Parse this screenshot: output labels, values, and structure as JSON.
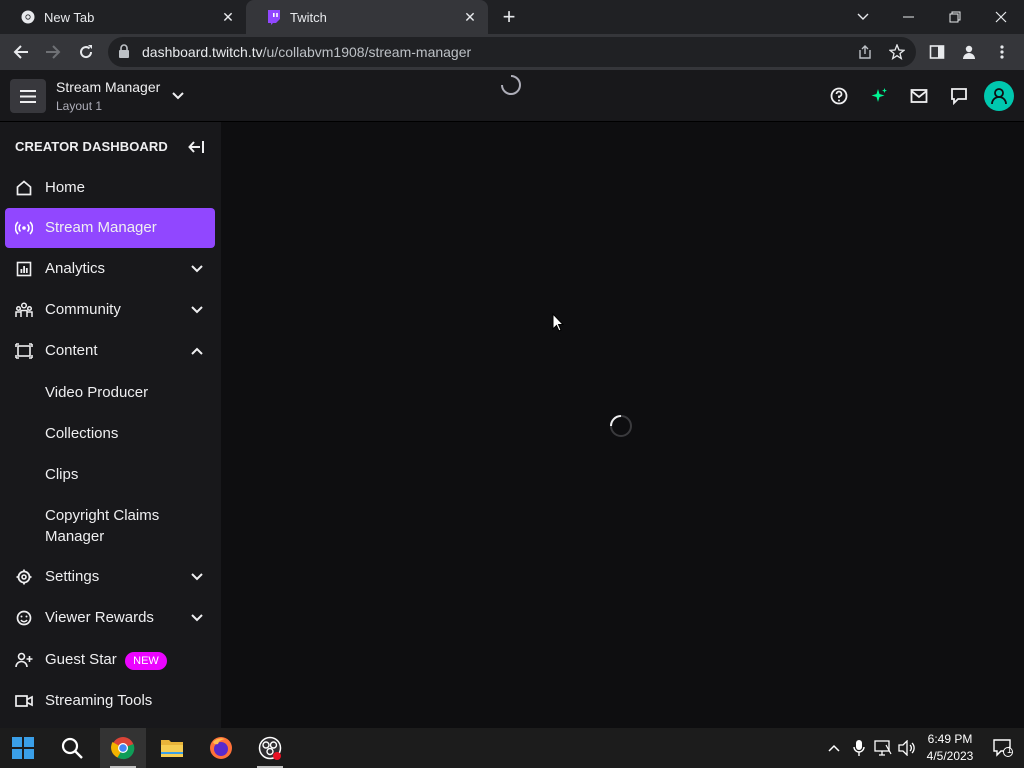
{
  "browser": {
    "tabs": [
      {
        "title": "New Tab"
      },
      {
        "title": "Twitch"
      }
    ],
    "url_host": "dashboard.twitch.tv",
    "url_path": "/u/collabvm1908/stream-manager"
  },
  "header": {
    "page_title": "Stream Manager",
    "layout_name": "Layout 1"
  },
  "sidebar": {
    "title": "CREATOR DASHBOARD",
    "items": [
      {
        "label": "Home",
        "icon": "home-icon"
      },
      {
        "label": "Stream Manager",
        "icon": "broadcast-icon",
        "active": true
      },
      {
        "label": "Analytics",
        "icon": "analytics-icon",
        "expandable": true
      },
      {
        "label": "Community",
        "icon": "community-icon",
        "expandable": true
      },
      {
        "label": "Content",
        "icon": "content-icon",
        "expanded": true
      },
      {
        "label": "Settings",
        "icon": "gear-icon",
        "expandable": true
      },
      {
        "label": "Viewer Rewards",
        "icon": "smiley-icon",
        "expandable": true
      },
      {
        "label": "Guest Star",
        "icon": "add-person-icon",
        "badge": "NEW"
      },
      {
        "label": "Streaming Tools",
        "icon": "camera-icon"
      }
    ],
    "content_subitems": [
      {
        "label": "Video Producer"
      },
      {
        "label": "Collections"
      },
      {
        "label": "Clips"
      },
      {
        "label": "Copyright Claims Manager"
      }
    ]
  },
  "taskbar": {
    "time": "6:49 PM",
    "date": "4/5/2023",
    "notification_count": "1"
  },
  "colors": {
    "accent": "#9147ff",
    "badge": "#eb04ff",
    "avatar": "#00c8af"
  }
}
